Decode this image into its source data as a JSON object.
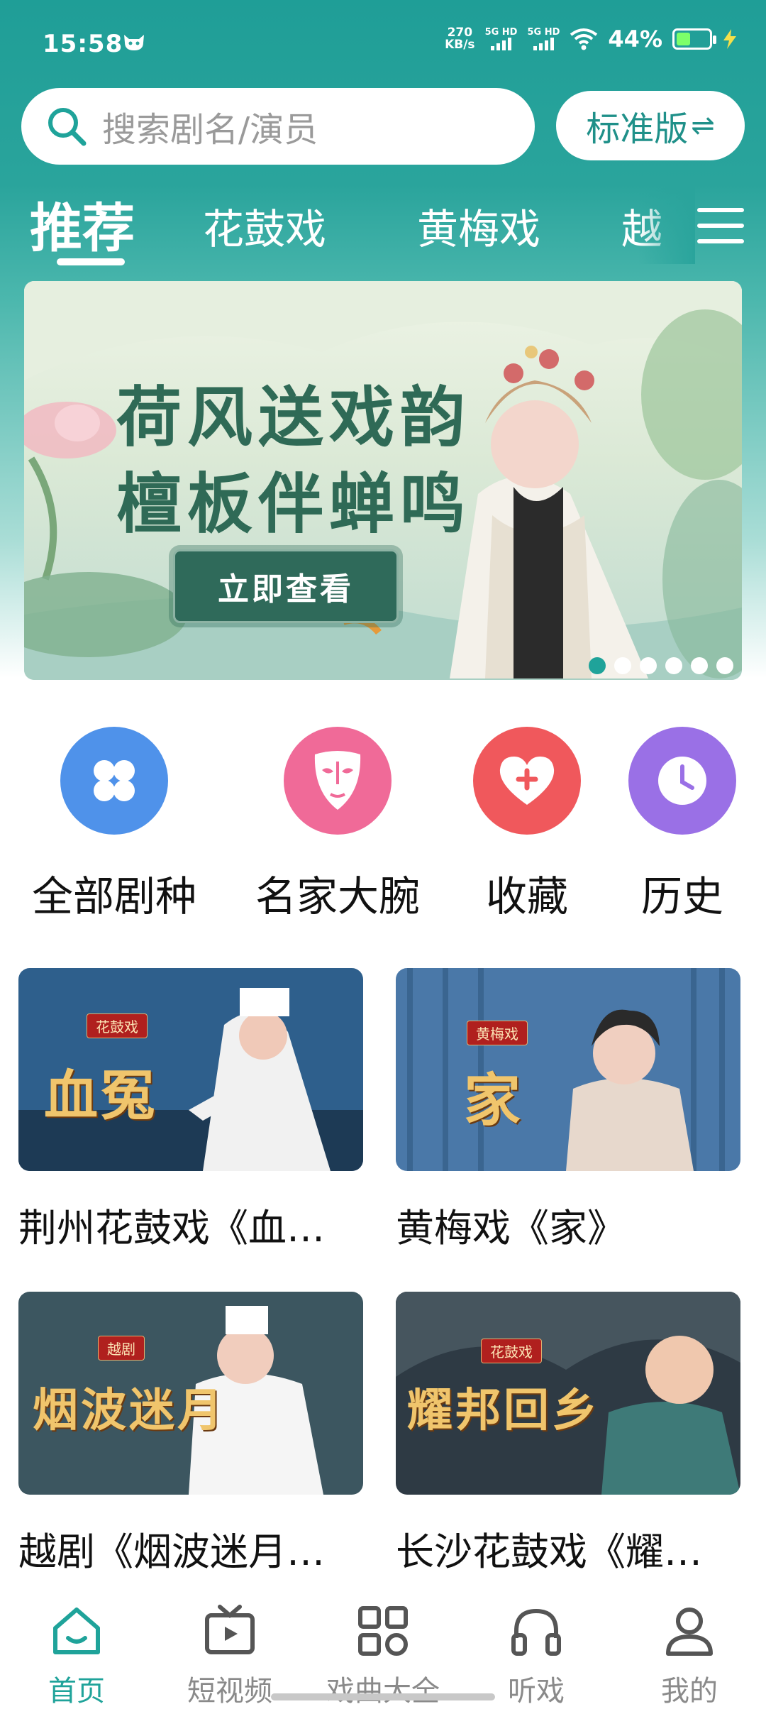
{
  "status_bar": {
    "time": "15:58",
    "net_speed_value": "270",
    "net_speed_unit": "KB/s",
    "sim1": "5G HD",
    "sim2": "5G HD",
    "battery_percent_text": "44%",
    "battery_level": 0.44
  },
  "search": {
    "placeholder": "搜索剧名/演员",
    "edition_label": "标准版",
    "edition_swap_glyph": "⇌"
  },
  "tabs": [
    {
      "label": "推荐",
      "active": true
    },
    {
      "label": "花鼓戏",
      "active": false
    },
    {
      "label": "黄梅戏",
      "active": false
    },
    {
      "label": "越",
      "active": false
    }
  ],
  "banner": {
    "line1": "荷风送戏韵",
    "line2": "檀板伴蝉鸣",
    "button": "立即查看",
    "slide_count": 6,
    "active_slide": 1
  },
  "quick_entries": [
    {
      "label": "全部剧种",
      "icon": "clover-icon",
      "color": "#4f92ea"
    },
    {
      "label": "名家大腕",
      "icon": "opera-mask-icon",
      "color": "#f06a98"
    },
    {
      "label": "收藏",
      "icon": "heart-plus-icon",
      "color": "#f0585c"
    },
    {
      "label": "历史",
      "icon": "clock-icon",
      "color": "#9a70e6"
    }
  ],
  "cards": [
    {
      "title": "荆州花鼓戏《血…",
      "tag": "花鼓戏",
      "calligraphy": "血冤"
    },
    {
      "title": "黄梅戏《家》",
      "tag": "黄梅戏",
      "calligraphy": "家"
    },
    {
      "title": "越剧《烟波迷月…",
      "tag": "越剧",
      "calligraphy": "烟波迷月"
    },
    {
      "title": "长沙花鼓戏《耀…",
      "tag": "花鼓戏",
      "calligraphy": "耀邦回乡"
    }
  ],
  "bottom_nav": [
    {
      "label": "首页",
      "icon": "home-icon",
      "active": true
    },
    {
      "label": "短视频",
      "icon": "tv-play-icon",
      "active": false
    },
    {
      "label": "戏曲大全",
      "icon": "grid-icon",
      "active": false
    },
    {
      "label": "听戏",
      "icon": "headphones-icon",
      "active": false
    },
    {
      "label": "我的",
      "icon": "user-icon",
      "active": false
    }
  ],
  "colors": {
    "primary_teal": "#1fa39a",
    "header_teal": "#2aa49c"
  }
}
